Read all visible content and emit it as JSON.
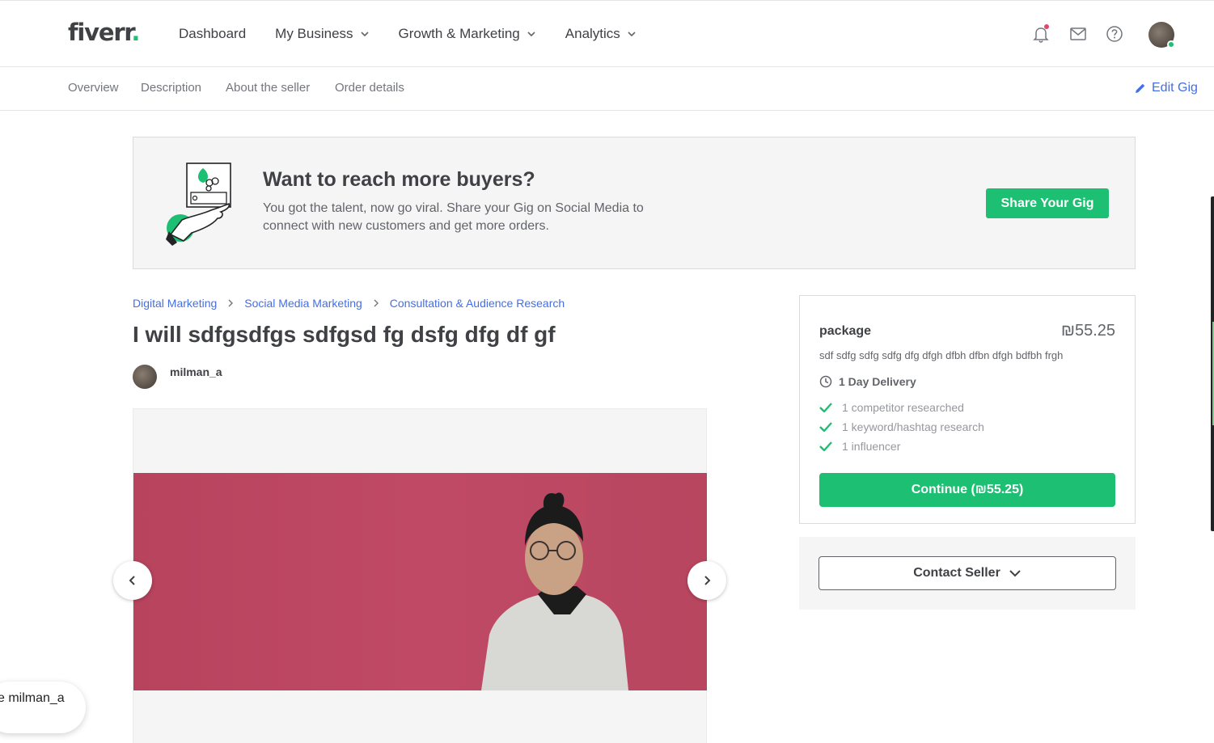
{
  "header": {
    "logo_text": "fiverr",
    "logo_dot": ".",
    "nav": [
      {
        "label": "Dashboard",
        "dropdown": false
      },
      {
        "label": "My Business",
        "dropdown": true
      },
      {
        "label": "Growth & Marketing",
        "dropdown": true
      },
      {
        "label": "Analytics",
        "dropdown": true
      }
    ]
  },
  "subnav": {
    "items": [
      "Overview",
      "Description",
      "About the seller",
      "Order details"
    ],
    "edit_label": "Edit Gig"
  },
  "banner": {
    "title": "Want to reach more buyers?",
    "text": "You got the talent, now go viral. Share your Gig on Social Media to connect with new customers and get more orders.",
    "button": "Share Your Gig"
  },
  "breadcrumb": [
    "Digital Marketing",
    "Social Media Marketing",
    "Consultation & Audience Research"
  ],
  "gig": {
    "title": "I will sdfgsdfgs sdfgsd fg dsfg dfg df gf",
    "seller": "milman_a"
  },
  "package": {
    "name": "package",
    "price": "₪55.25",
    "description": "sdf sdfg sdfg sdfg dfg dfgh dfbh dfbn dfgh bdfbh frgh",
    "delivery": "1 Day Delivery",
    "features": [
      "1 competitor researched",
      "1 keyword/hashtag research",
      "1 influencer"
    ],
    "continue_label": "Continue (₪55.25)"
  },
  "contact": {
    "label": "Contact Seller"
  },
  "chat": {
    "label": "e milman_a"
  },
  "colors": {
    "brand": "#1dbf73",
    "link": "#446ee7",
    "text": "#404145"
  }
}
